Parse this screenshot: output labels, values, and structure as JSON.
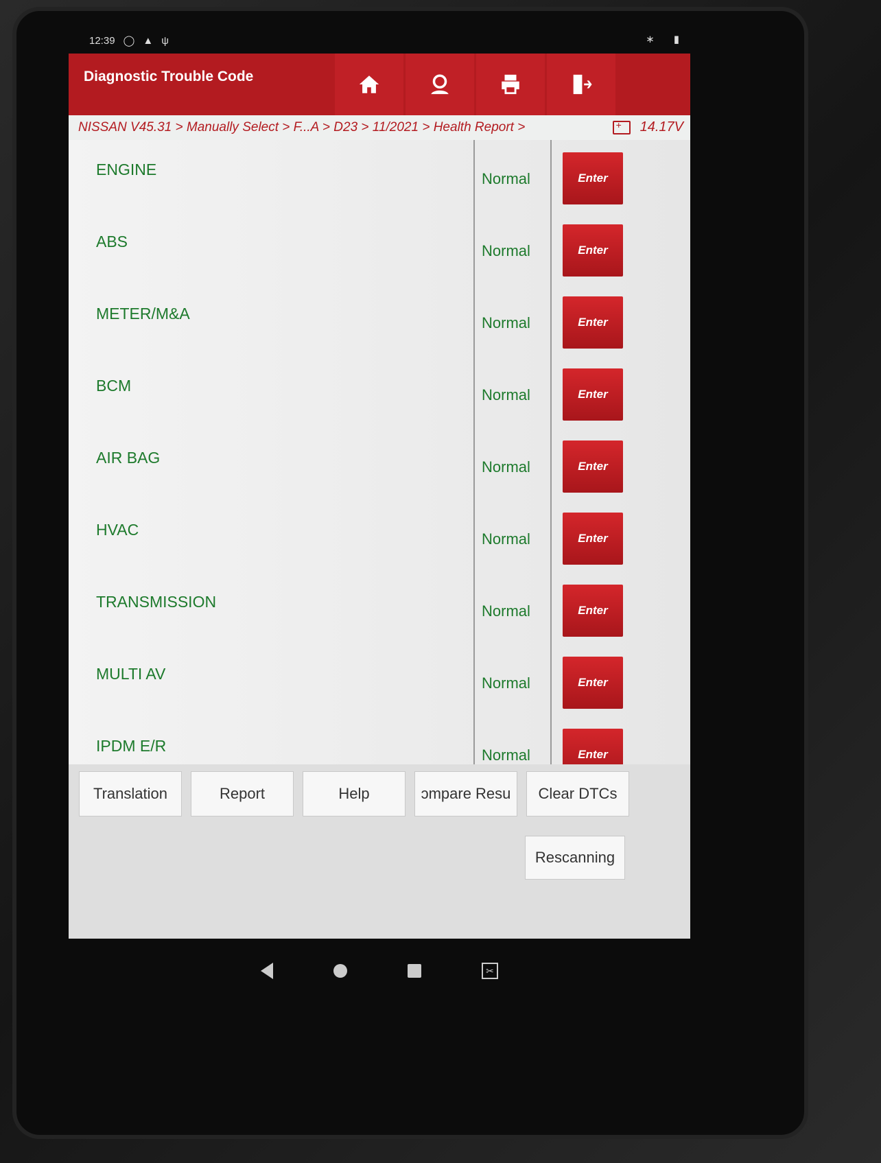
{
  "status_bar": {
    "time": "12:39",
    "left_icons": [
      "notification-icon",
      "alert-icon",
      "usb-icon"
    ],
    "right_icons": [
      "bluetooth-icon",
      "battery-icon"
    ]
  },
  "header": {
    "title": "Diagnostic Trouble Code",
    "buttons": [
      {
        "icon": "home-icon"
      },
      {
        "icon": "user-icon"
      },
      {
        "icon": "print-icon"
      },
      {
        "icon": "exit-icon"
      }
    ]
  },
  "breadcrumb": {
    "path": "NISSAN V45.31 > Manually Select > F...A > D23 > 11/2021 > Health Report >",
    "voltage": "14.17V"
  },
  "systems": [
    {
      "name": "ENGINE",
      "status": "Normal",
      "action": "Enter"
    },
    {
      "name": "ABS",
      "status": "Normal",
      "action": "Enter"
    },
    {
      "name": "METER/M&A",
      "status": "Normal",
      "action": "Enter"
    },
    {
      "name": "BCM",
      "status": "Normal",
      "action": "Enter"
    },
    {
      "name": "AIR BAG",
      "status": "Normal",
      "action": "Enter"
    },
    {
      "name": "HVAC",
      "status": "Normal",
      "action": "Enter"
    },
    {
      "name": "TRANSMISSION",
      "status": "Normal",
      "action": "Enter"
    },
    {
      "name": "MULTI AV",
      "status": "Normal",
      "action": "Enter"
    },
    {
      "name": "IPDM E/R",
      "status": "Normal",
      "action": "Enter"
    }
  ],
  "bottom_buttons": {
    "translation": "Translation",
    "report": "Report",
    "help": "Help",
    "compare": "ɔmpare Resu",
    "clear": "Clear DTCs",
    "rescanning": "Rescanning"
  },
  "colors": {
    "accent": "#b31b20",
    "status_text": "#1d7a2c"
  }
}
